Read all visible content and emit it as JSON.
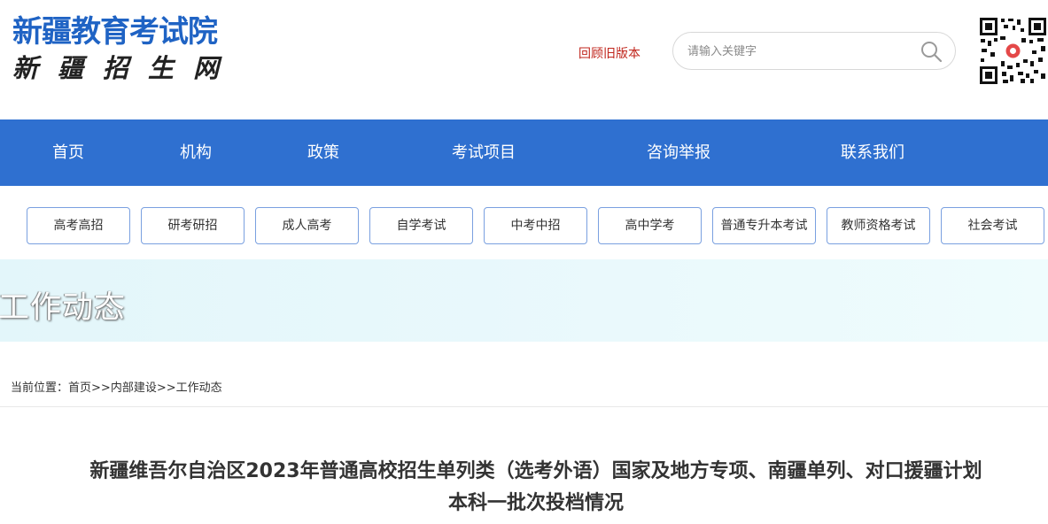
{
  "header": {
    "logo_title": "新疆教育考试院",
    "logo_subtitle": "新疆招生网",
    "old_version_link": "回顾旧版本",
    "search": {
      "placeholder": "请输入关键字"
    }
  },
  "main_nav": [
    {
      "label": "首页"
    },
    {
      "label": "机构"
    },
    {
      "label": "政策"
    },
    {
      "label": "考试项目"
    },
    {
      "label": "咨询举报"
    },
    {
      "label": "联系我们"
    }
  ],
  "sub_nav": [
    {
      "label": "高考高招"
    },
    {
      "label": "研考研招"
    },
    {
      "label": "成人高考"
    },
    {
      "label": "自学考试"
    },
    {
      "label": "中考中招"
    },
    {
      "label": "高中学考"
    },
    {
      "label": "普通专升本考试"
    },
    {
      "label": "教师资格考试"
    },
    {
      "label": "社会考试"
    }
  ],
  "banner": {
    "title": "工作动态"
  },
  "breadcrumb": {
    "prefix": "当前位置：",
    "items": [
      "首页",
      "内部建设",
      "工作动态"
    ],
    "separator": ">>"
  },
  "article": {
    "title_line1": "新疆维吾尔自治区2023年普通高校招生单列类（选考外语）国家及地方专项、南疆单列、对口援疆计划",
    "title_line2": "本科一批次投档情况"
  },
  "colors": {
    "brand_blue": "#1f63c4",
    "nav_blue": "#2f70d0",
    "old_version_red": "#c0251c",
    "banner_bg": "#e3f6fa"
  }
}
